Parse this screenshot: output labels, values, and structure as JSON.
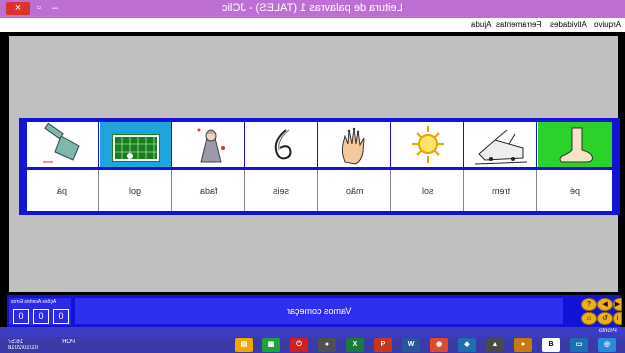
{
  "window": {
    "title": "Leitura de palavras 1 (TALES) - JClic",
    "close": "×",
    "restore": "▫",
    "minimize": "–"
  },
  "menu": [
    {
      "label": "Arquivo"
    },
    {
      "label": "Atividades"
    },
    {
      "label": "Ferramentas"
    },
    {
      "label": "Ajuda"
    }
  ],
  "pictures": [
    {
      "name": "shovel-icon",
      "bg": "#ffffff"
    },
    {
      "name": "goal-icon",
      "bg": "#1ea6dc"
    },
    {
      "name": "fairy-icon",
      "bg": "#ffffff"
    },
    {
      "name": "number-six-icon",
      "bg": "#ffffff"
    },
    {
      "name": "hand-icon",
      "bg": "#ffffff"
    },
    {
      "name": "sun-icon",
      "bg": "#ffffff"
    },
    {
      "name": "train-icon",
      "bg": "#ffffff"
    },
    {
      "name": "foot-icon",
      "bg": "#2ad22a"
    }
  ],
  "words": [
    "pá",
    "gol",
    "fada",
    "seis",
    "mão",
    "sol",
    "trem",
    "pé"
  ],
  "counters": {
    "labels": "Ações  Acertos  Erros",
    "values": [
      "0",
      "0",
      "0"
    ]
  },
  "message": "Vamos começar",
  "status": "Pronto",
  "taskbar": {
    "time": "16:57",
    "date": "01/10/2018",
    "lang": "POR"
  },
  "colors": {
    "board": "#1313d6",
    "title_bar": "#bd6fd3",
    "workspace": "#c0c0c0"
  }
}
